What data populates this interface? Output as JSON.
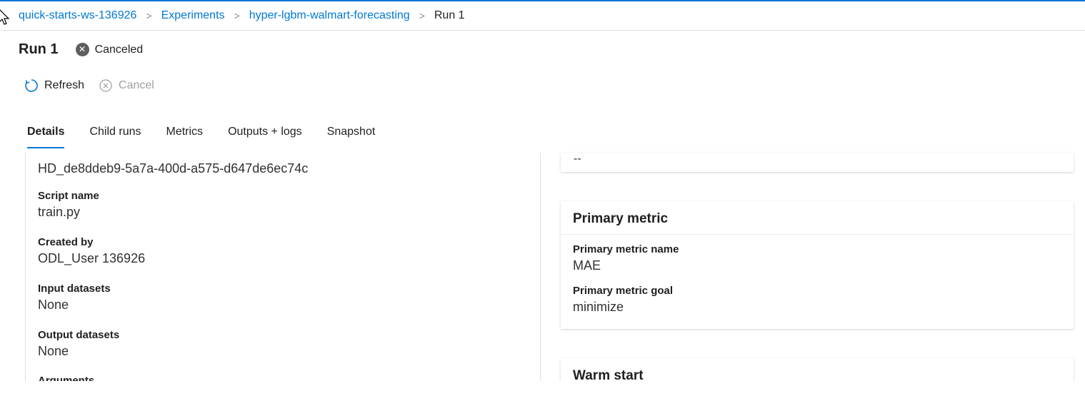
{
  "breadcrumb": {
    "items": [
      "quick-starts-ws-136926",
      "Experiments",
      "hyper-lgbm-walmart-forecasting"
    ],
    "current": "Run 1"
  },
  "header": {
    "title": "Run 1",
    "status": "Canceled"
  },
  "toolbar": {
    "refresh_label": "Refresh",
    "cancel_label": "Cancel"
  },
  "tabs": [
    {
      "label": "Details",
      "active": true
    },
    {
      "label": "Child runs",
      "active": false
    },
    {
      "label": "Metrics",
      "active": false
    },
    {
      "label": "Outputs + logs",
      "active": false
    },
    {
      "label": "Snapshot",
      "active": false
    }
  ],
  "details": {
    "run_id": "HD_de8ddeb9-5a7a-400d-a575-d647de6ec74c",
    "script_name_label": "Script name",
    "script_name_value": "train.py",
    "created_by_label": "Created by",
    "created_by_value": "ODL_User 136926",
    "input_datasets_label": "Input datasets",
    "input_datasets_value": "None",
    "output_datasets_label": "Output datasets",
    "output_datasets_value": "None",
    "arguments_label": "Arguments"
  },
  "right": {
    "top_card_value": "--",
    "primary_metric": {
      "title": "Primary metric",
      "name_label": "Primary metric name",
      "name_value": "MAE",
      "goal_label": "Primary metric goal",
      "goal_value": "minimize"
    },
    "warm_start_title": "Warm start"
  },
  "colors": {
    "accent": "#0078d4",
    "status_icon": "#605e5c"
  }
}
